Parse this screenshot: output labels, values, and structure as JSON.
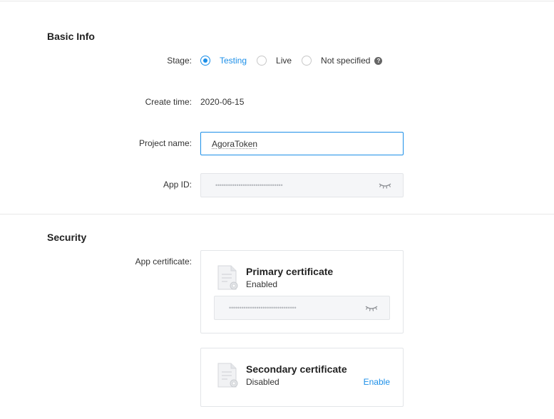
{
  "basic_info": {
    "title": "Basic Info",
    "stage": {
      "label": "Stage:",
      "options": [
        "Testing",
        "Live",
        "Not specified"
      ],
      "selected": "Testing"
    },
    "create_time": {
      "label": "Create time:",
      "value": "2020-06-15"
    },
    "project_name": {
      "label": "Project name:",
      "value": "AgoraToken"
    },
    "app_id": {
      "label": "App ID:",
      "masked_value": "••••••••••••••••••••••••••••••••"
    }
  },
  "security": {
    "title": "Security",
    "app_certificate_label": "App certificate:",
    "primary": {
      "title": "Primary certificate",
      "status": "Enabled",
      "masked_value": "••••••••••••••••••••••••••••••••"
    },
    "secondary": {
      "title": "Secondary certificate",
      "status": "Disabled",
      "action": "Enable"
    }
  },
  "colors": {
    "accent": "#1c8fe8",
    "field_bg": "#f5f6f8",
    "border": "#e3e5e8"
  },
  "icons": [
    "help-icon",
    "eye-closed-icon",
    "certificate-doc-icon"
  ]
}
